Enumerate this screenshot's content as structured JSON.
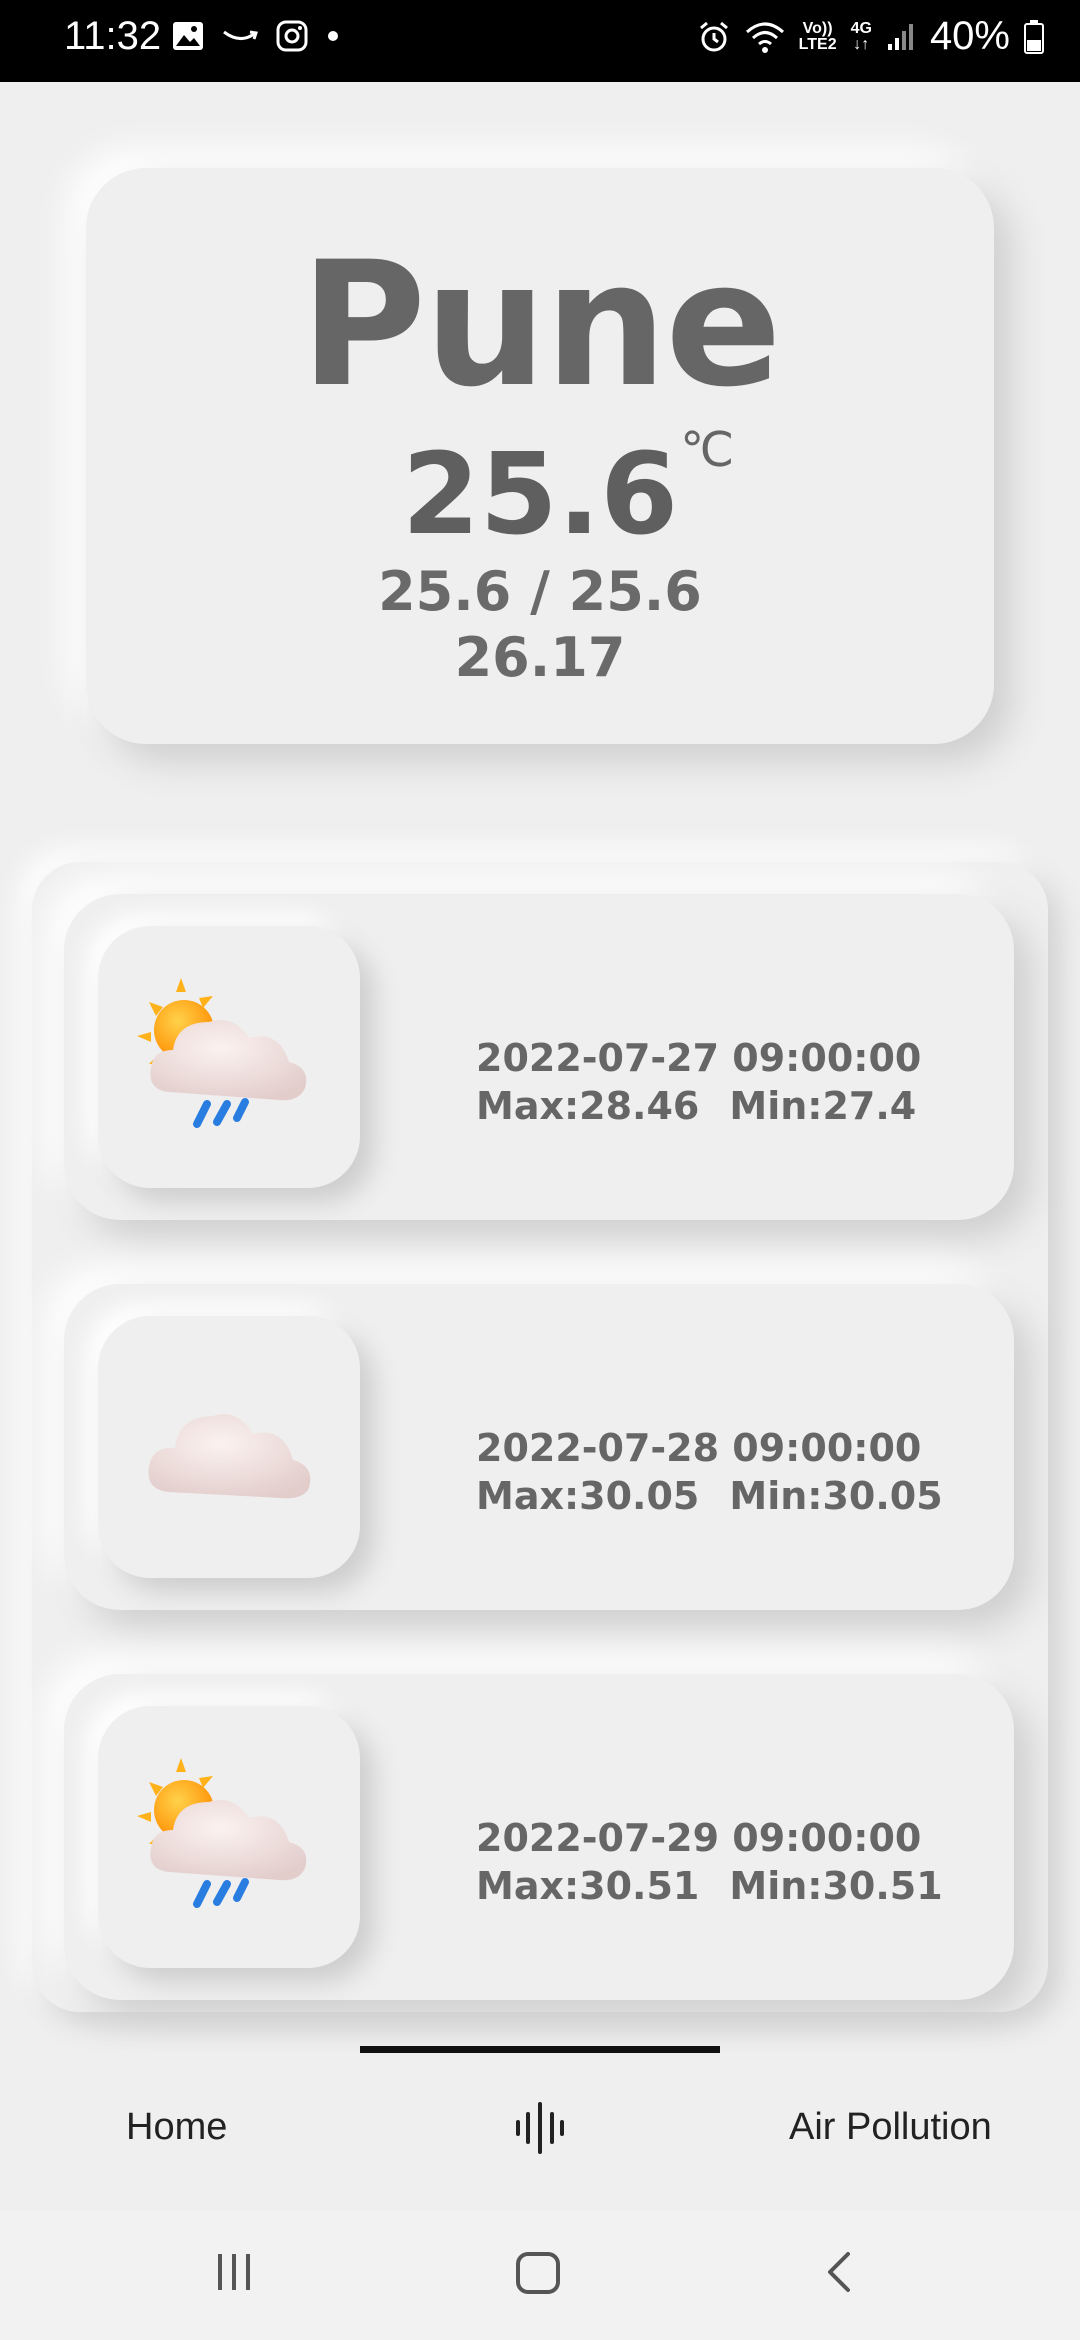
{
  "status_bar": {
    "time": "11:32",
    "battery": "40%",
    "volte_top": "Vo))",
    "volte_bottom": "LTE2",
    "network": "4G",
    "icons": [
      "gallery-icon",
      "amazon-icon",
      "instagram-icon",
      "dot-icon",
      "alarm-icon",
      "wifi-icon",
      "signal-icon",
      "battery-icon"
    ]
  },
  "current": {
    "city": "Pune",
    "temp": "25.6",
    "unit": "℃",
    "min_max": "25.6 / 25.6",
    "feels": "26.17"
  },
  "forecast": [
    {
      "datetime": "2022-07-27 09:00:00",
      "max": "Max:28.46",
      "min": "Min:27.4",
      "icon": "sun-cloud-rain-icon"
    },
    {
      "datetime": "2022-07-28 09:00:00",
      "max": "Max:30.05",
      "min": "Min:30.05",
      "icon": "cloud-icon"
    },
    {
      "datetime": "2022-07-29 09:00:00",
      "max": "Max:30.51",
      "min": "Min:30.51",
      "icon": "sun-cloud-rain-icon"
    }
  ],
  "nav": {
    "home": "Home",
    "air": "Air Pollution",
    "center_icon": "waveform-icon"
  },
  "system_nav": [
    "recents-icon",
    "home-icon",
    "back-icon"
  ]
}
